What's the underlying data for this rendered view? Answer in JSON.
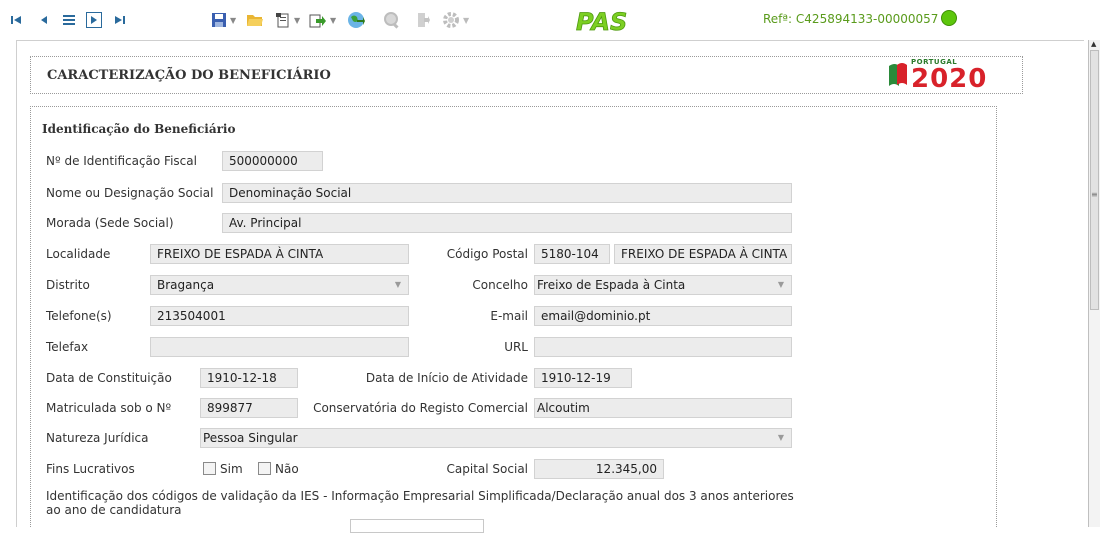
{
  "toolbar": {
    "reference": "Refª: C425894133-00000057",
    "status_color": "#5dc60c",
    "icons": [
      "first-record",
      "previous-record",
      "list",
      "next-record",
      "last-record",
      "save",
      "open-folder",
      "new-document",
      "export",
      "globe",
      "search",
      "exit",
      "settings",
      "pas-logo"
    ],
    "pas_logo_text": "PAS"
  },
  "header": {
    "title": "CARACTERIZAÇÃO DO BENEFICIÁRIO",
    "logo_small": "PORTUGAL",
    "logo_big": "2020"
  },
  "form": {
    "section_title": "Identificação do Beneficiário",
    "nif_label": "Nº de Identificação Fiscal",
    "nif_value": "500000000",
    "name_label": "Nome ou Designação Social",
    "name_value": "Denominação Social",
    "address_label": "Morada (Sede Social)",
    "address_value": "Av. Principal",
    "locality_label": "Localidade",
    "locality_value": "FREIXO DE ESPADA À CINTA",
    "postal_label": "Código Postal",
    "postal_code": "5180-104",
    "postal_locality": "FREIXO DE ESPADA À CINTA",
    "district_label": "Distrito",
    "district_value": "Bragança",
    "council_label": "Concelho",
    "council_value": "Freixo de Espada à Cinta",
    "phone_label": "Telefone(s)",
    "phone_value": "213504001",
    "email_label": "E-mail",
    "email_value": "email@dominio.pt",
    "fax_label": "Telefax",
    "fax_value": "",
    "url_label": "URL",
    "url_value": "",
    "constitution_label": "Data de Constituição",
    "constitution_value": "1910-12-18",
    "activity_start_label": "Data de Início de Atividade",
    "activity_start_value": "1910-12-19",
    "registered_label": "Matriculada sob o Nº",
    "registered_value": "899877",
    "registry_label": "Conservatória do Registo Comercial",
    "registry_value": "Alcoutim",
    "legal_nature_label": "Natureza Jurídica",
    "legal_nature_value": "Pessoa Singular",
    "profit_label": "Fins Lucrativos",
    "yes_label": "Sim",
    "no_label": "Não",
    "capital_label": "Capital Social",
    "capital_value": "12.345,00",
    "ies_note": "Identificação dos códigos de validação da IES - Informação Empresarial Simplificada/Declaração anual dos 3 anos anteriores ao ano de candidatura"
  }
}
